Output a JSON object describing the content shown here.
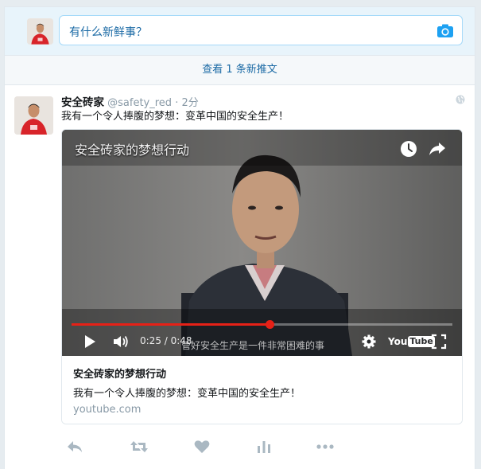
{
  "composer": {
    "placeholder": "有什么新鲜事？",
    "avatar_icon": "user-avatar",
    "camera_icon": "camera-icon"
  },
  "new_tweets_bar": {
    "label": "查看 1 条新推文"
  },
  "tweet": {
    "author_name": "安全砖家",
    "author_handle": "@safety_red",
    "separator": "·",
    "time": "2分",
    "text": "我有一个令人捧腹的梦想：变革中国的安全生产！",
    "globe_icon": "globe-icon",
    "video": {
      "title": "安全砖家的梦想行动",
      "subtitle": "管好安全生产是一件非常困难的事",
      "timecode": "0:25 / 0:48",
      "progress_fraction": 0.52,
      "youtube_you": "You",
      "youtube_tube": "Tube",
      "icons": [
        "clock-icon",
        "share-icon",
        "play-icon",
        "volume-icon",
        "settings-gear-icon",
        "fullscreen-icon"
      ]
    },
    "card": {
      "title": "安全砖家的梦想行动",
      "description": "我有一个令人捧腹的梦想：变革中国的安全生产！",
      "domain": "youtube.com"
    },
    "actions": [
      "reply-icon",
      "retweet-icon",
      "like-heart-icon",
      "analytics-icon",
      "more-dots-icon"
    ]
  },
  "colors": {
    "link_blue": "#1b6aa5",
    "progress_red": "#e62117",
    "muted_gray": "#8899a6",
    "action_gray": "#aab8c2"
  }
}
